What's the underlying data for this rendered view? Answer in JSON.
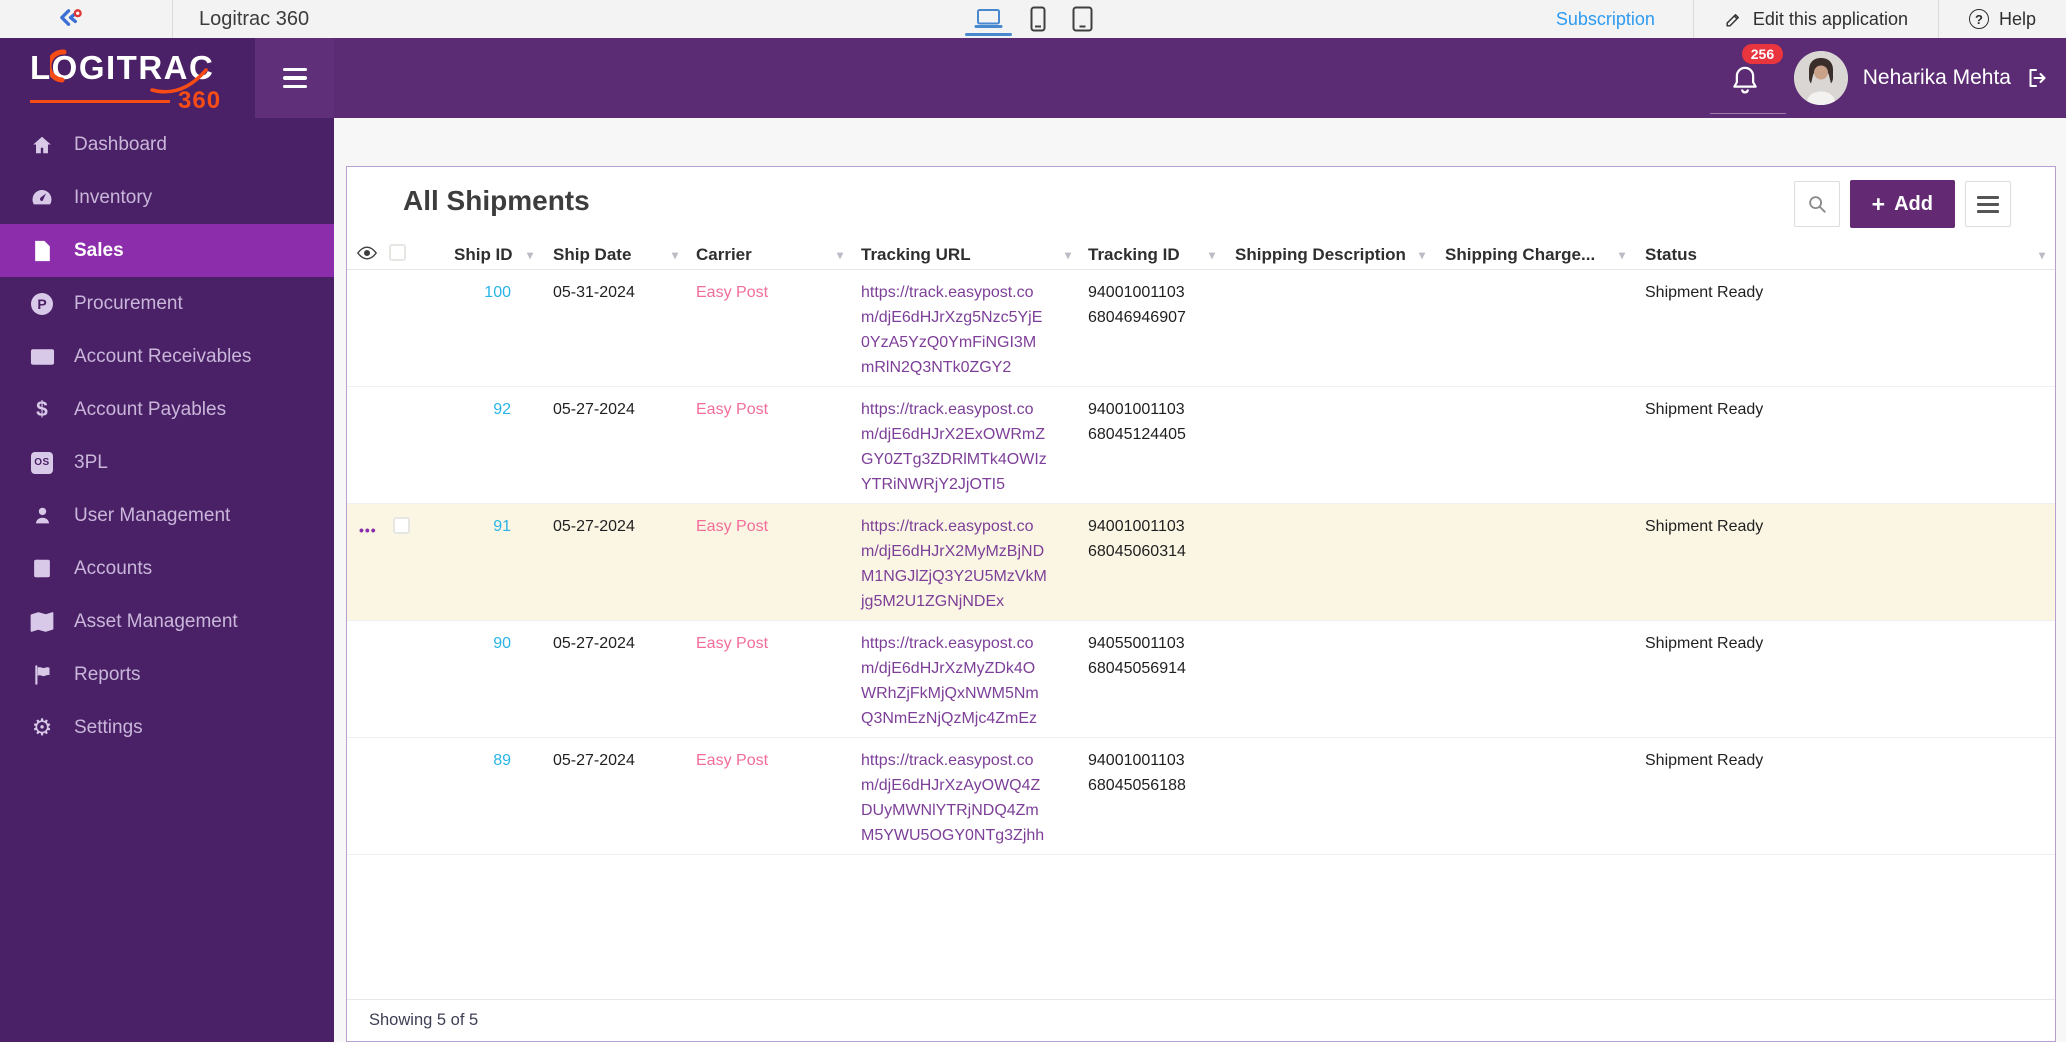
{
  "topbar": {
    "app_title": "Logitrac 360",
    "subscription_label": "Subscription",
    "edit_label": "Edit this application",
    "help_label": "Help"
  },
  "header": {
    "logo_text": "LOGITRAC",
    "logo_sub": "360",
    "notification_count": "256",
    "user_name": "Neharika Mehta"
  },
  "sidebar": {
    "active_item": "Sales",
    "items": [
      {
        "label": "Dashboard",
        "icon": "home-icon"
      },
      {
        "label": "Inventory",
        "icon": "gauge-icon"
      },
      {
        "label": "Sales",
        "icon": "file-icon"
      },
      {
        "label": "Procurement",
        "icon": "procurement-circle-icon"
      },
      {
        "label": "Account Receivables",
        "icon": "money-bill-icon"
      },
      {
        "label": "Account Payables",
        "icon": "dollar-icon"
      },
      {
        "label": "3PL",
        "icon": "threepl-badge-icon"
      },
      {
        "label": "User Management",
        "icon": "user-icon"
      },
      {
        "label": "Accounts",
        "icon": "book-icon"
      },
      {
        "label": "Asset Management",
        "icon": "map-icon"
      },
      {
        "label": "Reports",
        "icon": "flag-icon"
      },
      {
        "label": "Settings",
        "icon": "gear-icon"
      }
    ]
  },
  "main": {
    "title": "All Shipments",
    "add_button_label": "Add",
    "footer_text": "Showing 5 of 5",
    "table": {
      "columns": [
        "Ship ID",
        "Ship Date",
        "Carrier",
        "Tracking URL",
        "Tracking ID",
        "Shipping Description",
        "Shipping Charge...",
        "Status"
      ],
      "rows": [
        {
          "ship_id": "100",
          "ship_date": "05-31-2024",
          "carrier": "Easy Post",
          "tracking_url": "https://track.easypost.com/djE6dHJrXzg5Nzc5YjE0YzA5YzQ0YmFiNGI3MmRlN2Q3NTk0ZGY2",
          "tracking_id": "9400100110368046946907",
          "shipping_description": "",
          "shipping_charge": "",
          "status": "Shipment Ready",
          "highlighted": false
        },
        {
          "ship_id": "92",
          "ship_date": "05-27-2024",
          "carrier": "Easy Post",
          "tracking_url": "https://track.easypost.com/djE6dHJrX2ExOWRmZGY0ZTg3ZDRlMTk4OWIzYTRiNWRjY2JjOTI5",
          "tracking_id": "9400100110368045124405",
          "shipping_description": "",
          "shipping_charge": "",
          "status": "Shipment Ready",
          "highlighted": false
        },
        {
          "ship_id": "91",
          "ship_date": "05-27-2024",
          "carrier": "Easy Post",
          "tracking_url": "https://track.easypost.com/djE6dHJrX2MyMzBjNDM1NGJlZjQ3Y2U5MzVkMjg5M2U1ZGNjNDEx",
          "tracking_id": "9400100110368045060314",
          "shipping_description": "",
          "shipping_charge": "",
          "status": "Shipment Ready",
          "highlighted": true
        },
        {
          "ship_id": "90",
          "ship_date": "05-27-2024",
          "carrier": "Easy Post",
          "tracking_url": "https://track.easypost.com/djE6dHJrXzMyZDk4OWRhZjFkMjQxNWM5NmQ3NmEzNjQzMjc4ZmEz",
          "tracking_id": "9405500110368045056914",
          "shipping_description": "",
          "shipping_charge": "",
          "status": "Shipment Ready",
          "highlighted": false
        },
        {
          "ship_id": "89",
          "ship_date": "05-27-2024",
          "carrier": "Easy Post",
          "tracking_url": "https://track.easypost.com/djE6dHJrXzAyOWQ4ZDUyMWNlYTRjNDQ4ZmM5YWU5OGY0NTg3Zjhh",
          "tracking_id": "9400100110368045056188",
          "shipping_description": "",
          "shipping_charge": "",
          "status": "Shipment Ready",
          "highlighted": false
        }
      ]
    }
  },
  "icons": {
    "sort_caret": "▾",
    "add_plus": "+",
    "row_menu_dots": "•••",
    "help_glyph": "?",
    "procurement_glyph": "P",
    "threepl_glyph": "OS",
    "payables_glyph": "$",
    "settings_glyph": "⚙"
  },
  "colors": {
    "sidebar_purple": "#4a2166",
    "header_purple": "#5b2c74",
    "active_purple": "#8c2dab",
    "accent_orange": "#f84c16",
    "link_blue": "#2e9bf0",
    "ship_id_cyan": "#29b4e8",
    "carrier_pink": "#f26d9a",
    "url_purple": "#7d3f98",
    "badge_red": "#e8353e",
    "row_highlight": "#fbf6e4"
  }
}
